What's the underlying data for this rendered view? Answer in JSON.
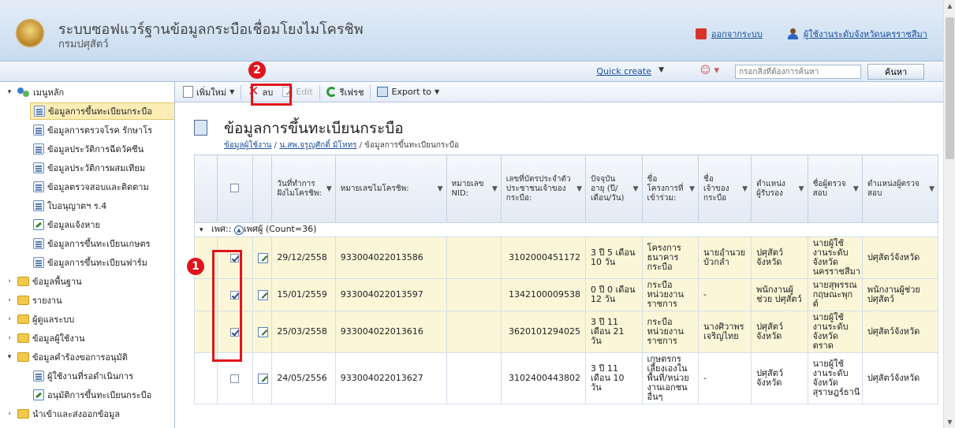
{
  "header": {
    "title": "ระบบซอฟแวร์ฐานข้อมูลกระบือเชื่อมโยงไมโครชิพ",
    "subtitle": "กรมปศุสัตว์",
    "logout_label": "ออกจากระบบ",
    "user_label": "ผู้ใช้งานระดับจังหวัดนครราชสีมา"
  },
  "topbar": {
    "quick_create": "Quick create",
    "search_placeholder": "กรอกสิ่งที่ต้องการค้นหา",
    "search_button": "ค้นหา"
  },
  "sidebar": {
    "root": "เมนูหลัก",
    "items": [
      {
        "label": "ข้อมูลการขึ้นทะเบียนกระบือ",
        "icon": "document-icon"
      },
      {
        "label": "ข้อมูลการตรวจโรค รักษาโร",
        "icon": "document-icon"
      },
      {
        "label": "ข้อมูลประวัติการฉีดวัคซีน",
        "icon": "document-icon"
      },
      {
        "label": "ข้อมูลประวัติการผสมเทียม",
        "icon": "document-icon"
      },
      {
        "label": "ข้อมูลตรวจสอบและติดตาม",
        "icon": "document-icon"
      },
      {
        "label": "ใบอนุญาตฯ ร.4",
        "icon": "document-icon"
      },
      {
        "label": "ข้อมูลแจ้งหาย",
        "icon": "edit-doc-icon"
      },
      {
        "label": "ข้อมูลการขึ้นทะเบียนเกษตร",
        "icon": "document-icon"
      },
      {
        "label": "ข้อมูลการขึ้นทะเบียนฟาร์ม",
        "icon": "document-icon"
      }
    ],
    "folders": [
      {
        "label": "ข้อมูลพื้นฐาน"
      },
      {
        "label": "รายงาน"
      },
      {
        "label": "ผู้ดูแลระบบ"
      },
      {
        "label": "ข้อมูลผู้ใช้งาน"
      },
      {
        "label": "ข้อมูลคำร้องขอการอนุมัติ"
      }
    ],
    "subitems": [
      {
        "label": "ผู้ใช้งานที่รอดำเนินการ"
      },
      {
        "label": "อนุมัติการขึ้นทะเบียนกระบือ"
      }
    ],
    "last_folder": "นำเข้าและส่งออกข้อมูล"
  },
  "toolbar": {
    "new": "เพิ่มใหม่",
    "delete": "ลบ",
    "edit": "Edit",
    "refresh": "รีเฟรช",
    "export": "Export to"
  },
  "page": {
    "title": "ข้อมูลการขึ้นทะเบียนกระบือ",
    "breadcrumb": [
      "ข้อมูลผู้ใช้งาน",
      "น.สพ.จรูญศักดิ์ มิโหทร",
      "ข้อมูลการขึ้นทะเบียนกระบือ"
    ]
  },
  "grid": {
    "columns": [
      "วันที่ทำการฝังไมโครชิพ:",
      "หมายเลขไมโครชิพ:",
      "หมายเลข NID:",
      "เลขที่บัตรประจำตัวประชาชนเจ้าของกระบือ:",
      "ปัจจุบันอายุ (ปี/เดือน/วัน)",
      "ชื่อโครงการที่เข้าร่วม:",
      "ชื่อเจ้าของกระบือ",
      "ตำแหน่งผู้รับรอง",
      "ชื่อผู้ตรวจสอบ",
      "ตำแหน่งผู้ตรวจสอบ"
    ],
    "group_label": "เพศ::",
    "group_value": "เพศผู้",
    "group_count": "(Count=36)",
    "rows": [
      {
        "checked": true,
        "date": "29/12/2558",
        "chip": "933004022013586",
        "nid": "",
        "idcard": "3102000451172",
        "age": "3 ปี 5 เดือน 10 วัน",
        "project": "โครงการธนาคารกระบือ",
        "owner": "นายอำนวย บัวกล่ำ",
        "certifier_pos": "ปศุสัตว์จังหวัด",
        "inspector": "นายผู้ใช้งานระดับจังหวัดนครราชสีมา",
        "inspector_pos": "ปศุสัตว์จังหวัด"
      },
      {
        "checked": true,
        "date": "15/01/2559",
        "chip": "933004022013597",
        "nid": "",
        "idcard": "1342100009538",
        "age": "0 ปี 0 เดือน 12 วัน",
        "project": "กระบือหน่วยงานราชการ",
        "owner": "-",
        "certifier_pos": "พนักงานผู้ช่วย ปศุสัตว์",
        "inspector": "นายสุพรรณ กฤษณะพุกต์",
        "inspector_pos": "พนักงานผู้ช่วย ปศุสัตว์"
      },
      {
        "checked": true,
        "date": "25/03/2558",
        "chip": "933004022013616",
        "nid": "",
        "idcard": "3620101294025",
        "age": "3 ปี 11 เดือน 21 วัน",
        "project": "กระบือหน่วยงานราชการ",
        "owner": "นางศิวาพร เจริญไทย",
        "certifier_pos": "ปศุสัตว์จังหวัด",
        "inspector": "นายผู้ใช้งานระดับจังหวัดตราด",
        "inspector_pos": "ปศุสัตว์จังหวัด"
      },
      {
        "checked": false,
        "date": "24/05/2556",
        "chip": "933004022013627",
        "nid": "",
        "idcard": "3102400443802",
        "age": "3 ปี 11 เดือน 10 วัน",
        "project": "เกษตรกรเลี้ยงเองในพื้นที่/หน่วยงานเอกชนอื่นๆ",
        "owner": "-",
        "certifier_pos": "ปศุสัตว์จังหวัด",
        "inspector": "นายผู้ใช้งานระดับจังหวัดสุราษฎร์ธานี",
        "inspector_pos": "ปศุสัตว์จังหวัด"
      }
    ]
  },
  "annotations": {
    "badge1": "1",
    "badge2": "2"
  },
  "colors": {
    "highlight": "#e0141c",
    "selected_row": "#fbf6d8",
    "link": "#1a4f9c"
  }
}
